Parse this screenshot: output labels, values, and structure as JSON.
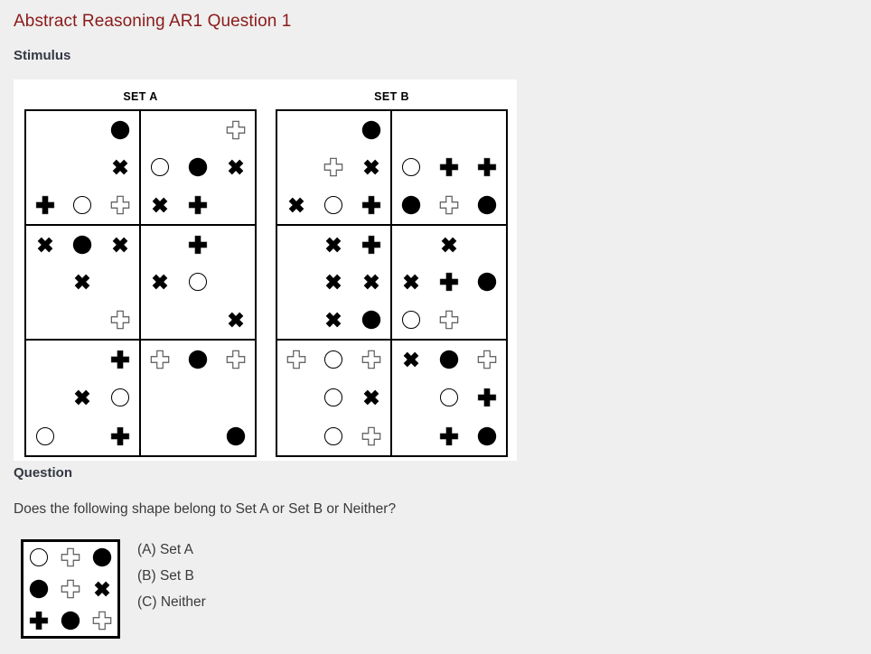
{
  "page": {
    "title": "Abstract Reasoning AR1 Question 1",
    "title_color": "#8b1a1a",
    "background_color": "#efefef"
  },
  "stimulus": {
    "label": "Stimulus",
    "set_a": {
      "heading": "SET A",
      "cells": [
        {
          "name": "set-a-cell-1",
          "shapes": [
            "",
            "",
            "filled-circle",
            "",
            "",
            "x-cross",
            "filled-plus",
            "open-circle",
            "open-plus"
          ]
        },
        {
          "name": "set-a-cell-2",
          "shapes": [
            "",
            "",
            "open-plus",
            "open-circle",
            "filled-circle",
            "x-cross",
            "x-cross",
            "filled-plus",
            ""
          ]
        },
        {
          "name": "set-a-cell-3",
          "shapes": [
            "x-cross",
            "filled-circle",
            "x-cross",
            "",
            "x-cross",
            "",
            "",
            "",
            "open-plus"
          ]
        },
        {
          "name": "set-a-cell-4",
          "shapes": [
            "",
            "filled-plus",
            "",
            "x-cross",
            "open-circle",
            "",
            "",
            "",
            "x-cross"
          ]
        },
        {
          "name": "set-a-cell-5",
          "shapes": [
            "",
            "",
            "filled-plus",
            "",
            "x-cross",
            "open-circle",
            "open-circle",
            "",
            "filled-plus"
          ]
        },
        {
          "name": "set-a-cell-6",
          "shapes": [
            "open-plus",
            "filled-circle",
            "open-plus",
            "",
            "",
            "",
            "",
            "",
            "filled-circle"
          ]
        }
      ]
    },
    "set_b": {
      "heading": "SET B",
      "cells": [
        {
          "name": "set-b-cell-1",
          "shapes": [
            "",
            "",
            "filled-circle",
            "",
            "open-plus",
            "x-cross",
            "x-cross",
            "open-circle",
            "filled-plus"
          ]
        },
        {
          "name": "set-b-cell-2",
          "shapes": [
            "",
            "",
            "",
            "open-circle",
            "filled-plus",
            "filled-plus",
            "filled-circle",
            "open-plus",
            "filled-circle"
          ]
        },
        {
          "name": "set-b-cell-3",
          "shapes": [
            "",
            "x-cross",
            "filled-plus",
            "",
            "x-cross",
            "x-cross",
            "",
            "x-cross",
            "filled-circle"
          ]
        },
        {
          "name": "set-b-cell-4",
          "shapes": [
            "",
            "x-cross",
            "",
            "x-cross",
            "filled-plus",
            "filled-circle",
            "open-circle",
            "open-plus",
            ""
          ]
        },
        {
          "name": "set-b-cell-5",
          "shapes": [
            "open-plus",
            "open-circle",
            "open-plus",
            "",
            "open-circle",
            "x-cross",
            "",
            "open-circle",
            "open-plus"
          ]
        },
        {
          "name": "set-b-cell-6",
          "shapes": [
            "x-cross",
            "filled-circle",
            "open-plus",
            "",
            "open-circle",
            "filled-plus",
            "",
            "filled-plus",
            "filled-circle"
          ]
        }
      ]
    }
  },
  "question": {
    "label": "Question",
    "text": "Does the following shape belong to Set A or Set B or Neither?",
    "candidate": {
      "name": "candidate-shape",
      "shapes": [
        "open-circle",
        "open-plus",
        "filled-circle",
        "filled-circle",
        "open-plus",
        "x-cross",
        "filled-plus",
        "filled-circle",
        "open-plus"
      ]
    },
    "options": [
      {
        "id": "option-a",
        "label": "(A) Set A"
      },
      {
        "id": "option-b",
        "label": "(B) Set B"
      },
      {
        "id": "option-c",
        "label": "(C) Neither"
      }
    ]
  }
}
